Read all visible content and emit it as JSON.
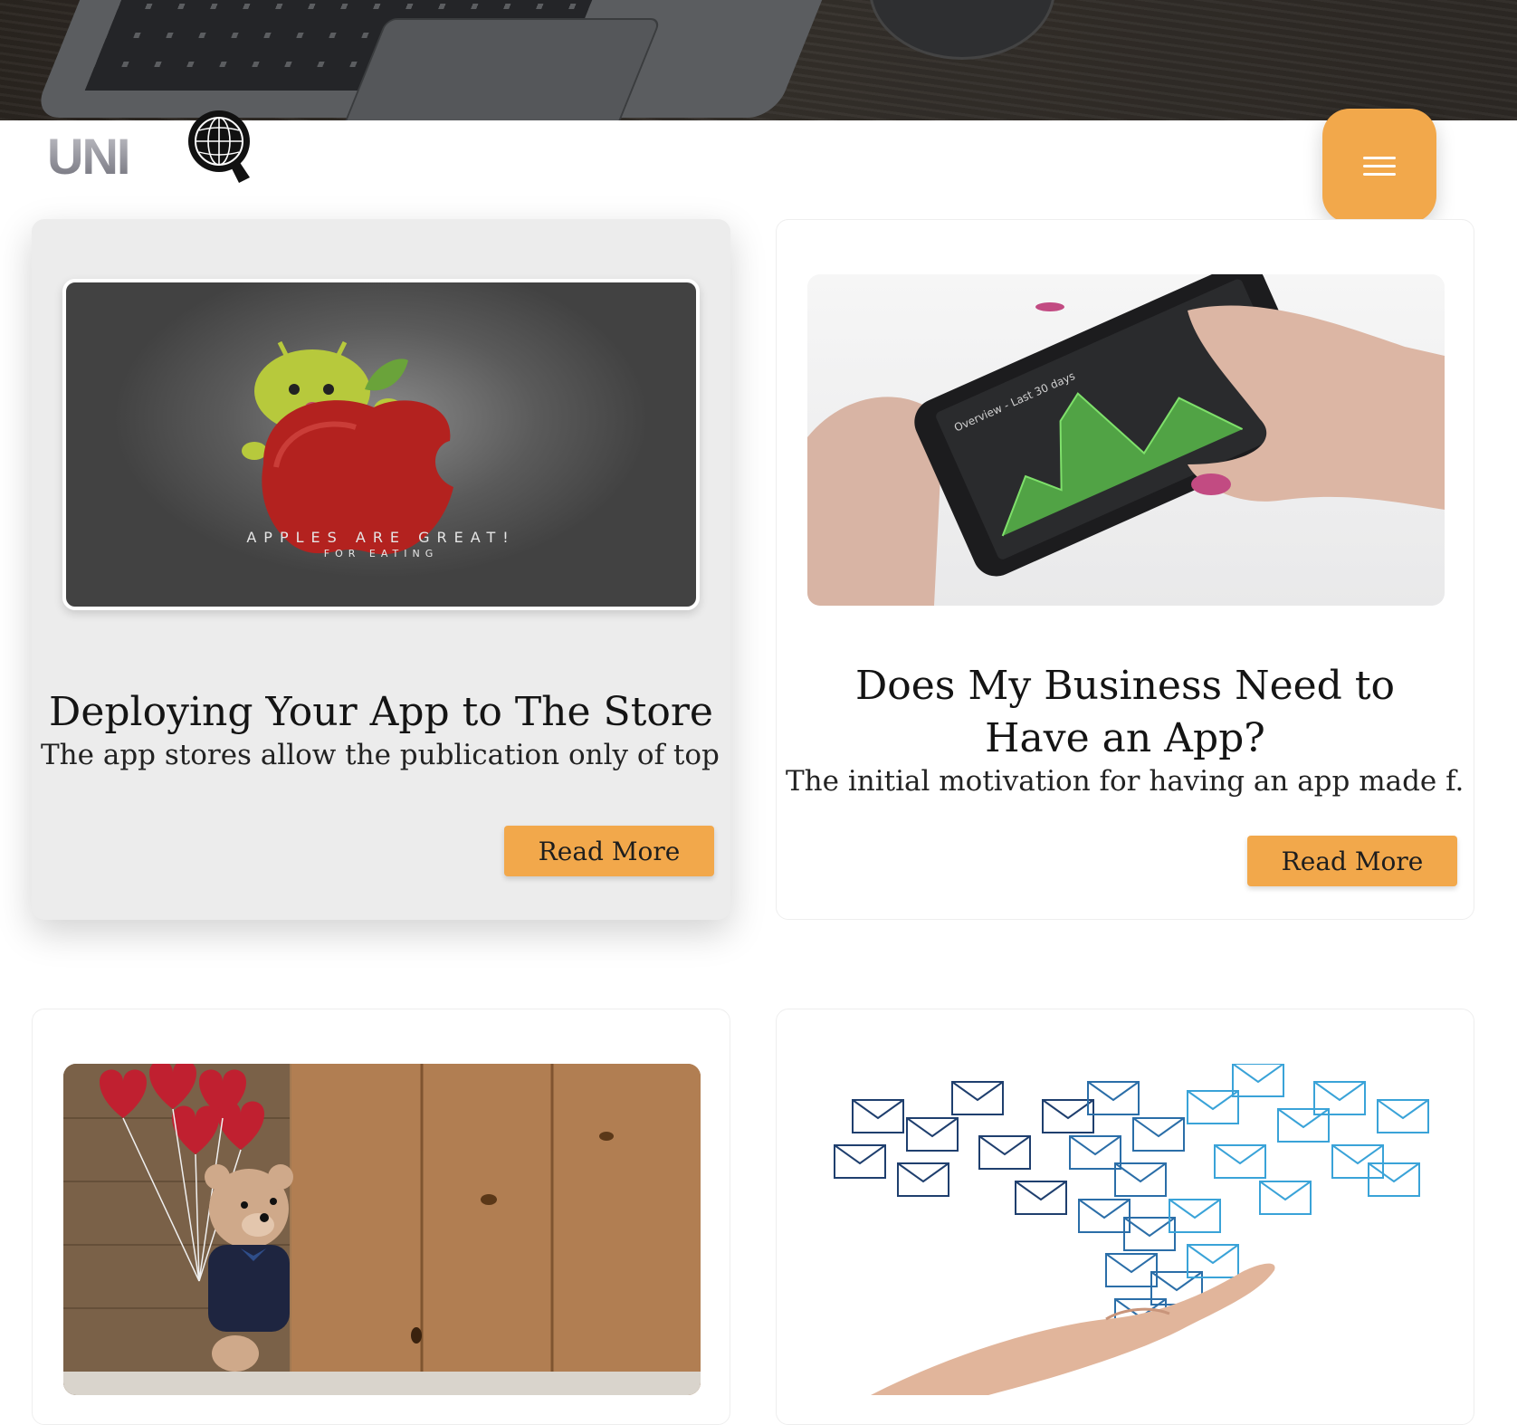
{
  "site": {
    "logo_text": "UNI",
    "logo_mark": "Q"
  },
  "header": {
    "menu_icon": "hamburger-icon"
  },
  "colors": {
    "accent": "#f2a84b",
    "text": "#141414"
  },
  "posts": [
    {
      "title": "Deploying Your App to The Store",
      "excerpt": "The app stores allow the publication only of top...",
      "button": "Read More",
      "image_caption_main": "APPLES ARE GREAT!",
      "image_caption_sub": "FOR EATING"
    },
    {
      "title": "Does My Business Need to Have an App?",
      "excerpt": "The initial motivation for having an app made f...",
      "button": "Read More",
      "phone_screen_label": "Overview - Last 30 days"
    },
    {},
    {}
  ]
}
